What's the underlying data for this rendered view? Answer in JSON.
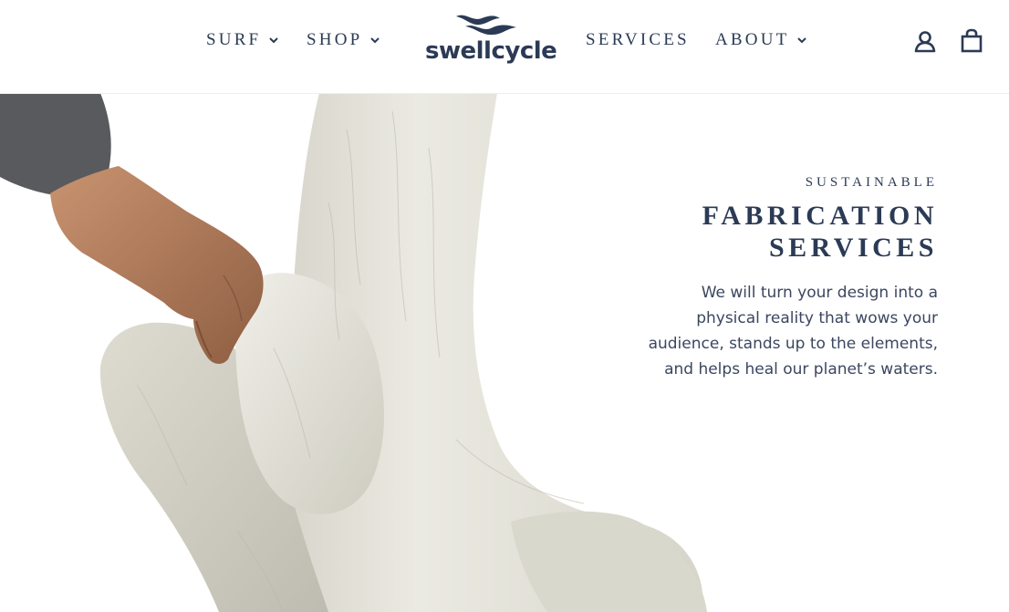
{
  "nav": {
    "surf": "SURF",
    "shop": "SHOP",
    "services": "SERVICES",
    "about": "ABOUT"
  },
  "logo": {
    "text": "swellcycle",
    "mark_icon": "wave-logo-icon"
  },
  "header_icons": {
    "account": "account-icon",
    "cart": "cart-icon"
  },
  "hero": {
    "eyebrow": "SUSTAINABLE",
    "headline_line1": "FABRICATION",
    "headline_line2": "SERVICES",
    "body": "We will turn your design into a physical reality that wows your audience, stands up to the elements, and helps heal our planet’s waters."
  },
  "colors": {
    "brand_navy": "#2b3a55",
    "sculpture": "#e3e2d8",
    "background": "#ffffff"
  }
}
